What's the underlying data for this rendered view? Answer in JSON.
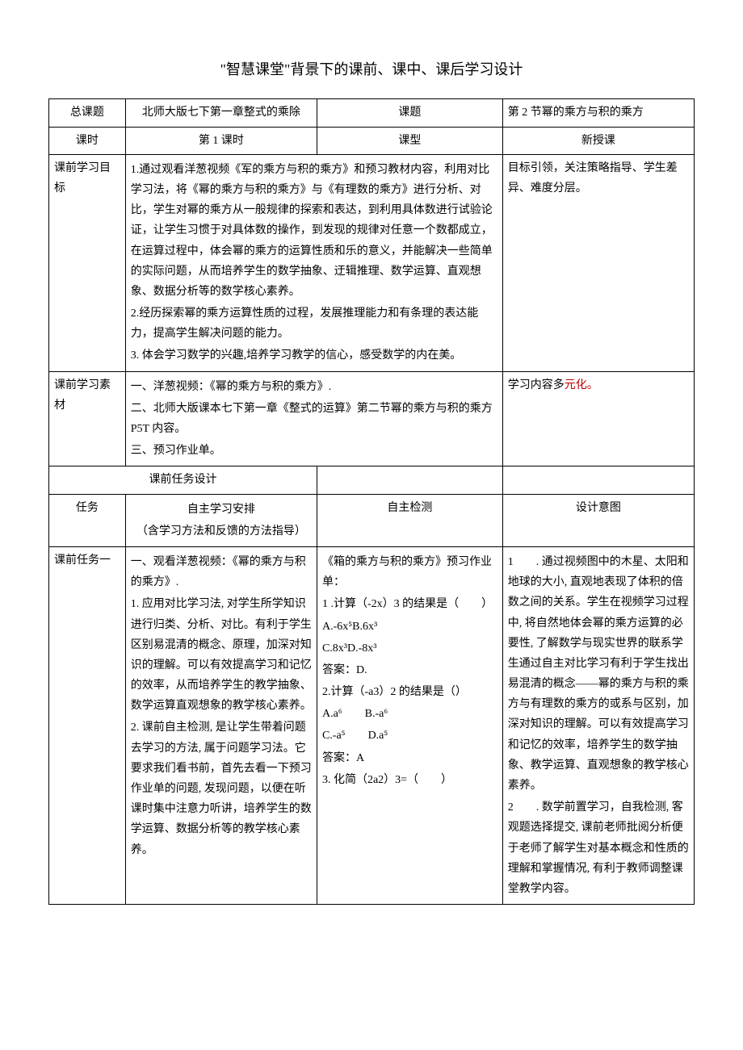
{
  "title": "\"智慧课堂\"背景下的课前、课中、课后学习设计",
  "row1": {
    "c1": "总课题",
    "c2": "北师大版七下第一章整式的乘除",
    "c3": "课题",
    "c4": "第 2 节幂的乘方与积的乘方"
  },
  "row2": {
    "c1": "课时",
    "c2": "第 1 课时",
    "c3": "课型",
    "c4": "新授课"
  },
  "row3": {
    "c1": "课前学习目标",
    "c2p1": "1.通过观看洋葱视频《军的乘方与积的乘方》和预习教材内容，利用对比学习法，将《幂的乘方与积的乘方》与《有理数的乘方》进行分析、对比，学生对幂的乘方从一般规律的探索和表达，到利用具体数进行试验论证，让学生习惯于对具体数的操作，到发现的规律对任意一个数都成立，在运算过程中，体会幂的乘方的运算性质和乐的意义，并能解决一些简单的实际问题，从而培养学生的数学抽象、迂辑推理、数学运算、直观想象、数据分析等的数学核心素养。",
    "c2p2": "2.经历探索幂的乘方运算性质的过程，发展推理能力和有条理的表达能力，提高学生解决问题的能力。",
    "c2p3": "3. 体会学习数学的兴趣,培养学习教学的信心，感受数学的内在美。",
    "c3": "目标引领，关注策略指导、学生差异、难度分层。"
  },
  "row4": {
    "c1": "课前学习素材",
    "c2p1": "一、洋葱视频：《幂的乘方与积的乘方》.",
    "c2p2": "二、北师大版课本七下第一章《整式的运算》第二节幂的乘方与积的乘方 P5T 内容。",
    "c2p3": "三、预习作业单。",
    "c3a": "学习内容多",
    "c3b": "元化。"
  },
  "row5": {
    "c1": "课前任务设计"
  },
  "row6": {
    "c1": "任务",
    "c2a": "自主学习安排",
    "c2b": "（含学习方法和反馈的方法指导）",
    "c3": "自主检测",
    "c4": "设计意图"
  },
  "row7": {
    "c1": "课前任务一",
    "c2p1": "一、观看洋葱视频：《幂的乘方与积的乘方》.",
    "c2p2": "1. 应用对比学习法, 对学生所学知识进行归类、分析、对比。有利于学生区别易混清的概念、原理，加深对知识的理解。可以有效提高学习和记忆的效率，从而培养学生的教学抽象、数学运算直观想象的教学核心素养。",
    "c2p3": "2. 课前自主检测, 是让学生带着问题去学习的方法, 属于问题学习法。它要求我们看书前，首先去看一下预习作业单的问题, 发现问题，以便在听课时集中注意力听讲，培养学生的数学运算、数据分析等的教学核心素养。",
    "c3p1": "《箱的乘方与积的乘方》预习作业单：",
    "c3p2": "1 .计算（-2x）3 的结果是（　　）",
    "c3p3": "A.-6x⁵B.6x³",
    "c3p4": "C.8x³D.-8x³",
    "c3p5": "答案：D.",
    "c3p6": "2.计算（-a3）2 的结果是（）",
    "c3p7a": "A.a⁶",
    "c3p7b": "B.-a⁶",
    "c3p8a": "C.-a⁵",
    "c3p8b": "D.a⁵",
    "c3p9": "答案：A",
    "c3p10": "3. 化简（2a2）3=（　　）",
    "c4p1": "1　　. 通过视频图中的木星、太阳和地球的大小, 直观地表现了体积的倍数之间的关系。学生在视频学习过程中, 将自然地体会幂的乘方运算的必要性, 了解数学与现实世界的联系学生通过自主对比学习有利于学生找出易混清的概念——幂的乘方与积的乘方与有理数的乘方的或系与区别，加深对知识的理解。可以有效提高学习和记忆的效率，培养学生的数学抽象、教学运算、直观想象的教学核心素养。",
    "c4p2": "2　　. 数学前置学习，自我检测, 客观题选择提交, 课前老师批阅分析便于老师了解学生对基本概念和性质的理解和掌握情况, 有利于教师调整课堂教学内容。"
  }
}
